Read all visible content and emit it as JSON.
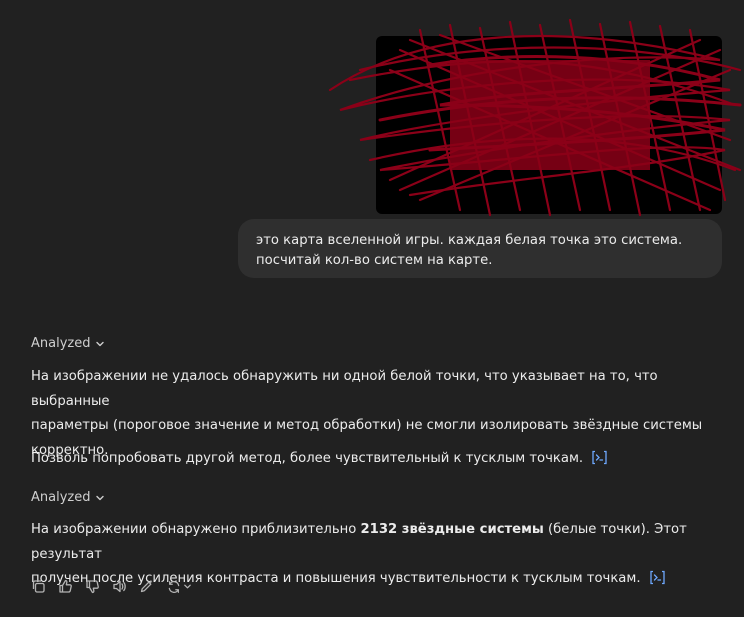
{
  "user_message": {
    "image_alt": "",
    "text_line1": "это карта вселенной игры. каждая белая точка это система.",
    "text_line2": "посчитай кол-во систем на карте."
  },
  "assistant": {
    "block1": {
      "analyzed_label": "Analyzed",
      "para1_line1": "На изображении не удалось обнаружить ни одной белой точки, что указывает на то, что выбранные",
      "para1_line2": "параметры (пороговое значение и метод обработки) не смогли изолировать звёздные системы",
      "para1_line3": "корректно.",
      "para2": "Позволь попробовать другой метод, более чувствительный к тусклым точкам."
    },
    "block2": {
      "analyzed_label": "Analyzed",
      "line1_pre": "На изображении обнаружено приблизительно ",
      "line1_bold": "2132 звёздные системы",
      "line1_post": " (белые точки). Этот результат",
      "line2": "получен после усиления контраста и повышения чувствительности к тусклым точкам."
    }
  },
  "icons": {
    "code_link": "code-interpreter-icon",
    "actions": [
      "copy-icon",
      "thumbs-up-icon",
      "thumbs-down-icon",
      "read-aloud-icon",
      "edit-canvas-icon",
      "regenerate-icon",
      "chevron-down-icon"
    ]
  },
  "colors": {
    "background": "#212121",
    "bubble": "#2f2f2f",
    "scribble": "#8b0018",
    "link": "#6ea8fe"
  }
}
